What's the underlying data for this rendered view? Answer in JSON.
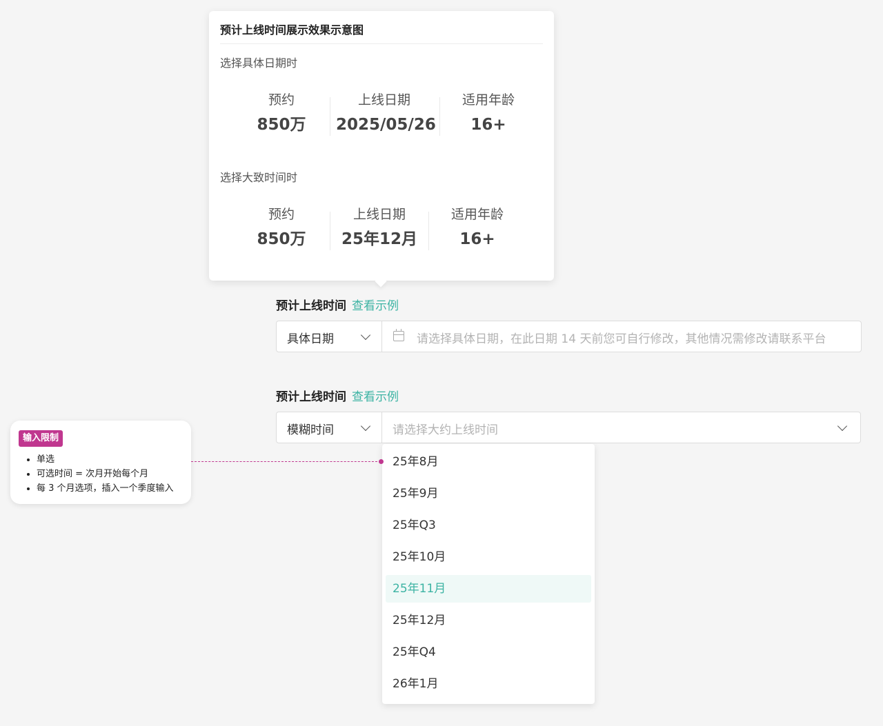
{
  "example_popover": {
    "title": "预计上线时间展示效果示意图",
    "specific": {
      "section": "选择具体日期时",
      "stats": [
        {
          "label": "预约",
          "value": "850万"
        },
        {
          "label": "上线日期",
          "value": "2025/05/26"
        },
        {
          "label": "适用年龄",
          "value": "16+"
        }
      ]
    },
    "approx": {
      "section": "选择大致时间时",
      "stats": [
        {
          "label": "预约",
          "value": "850万"
        },
        {
          "label": "上线日期",
          "value": "25年12月"
        },
        {
          "label": "适用年龄",
          "value": "16+"
        }
      ]
    }
  },
  "field_specific": {
    "label": "预计上线时间",
    "link": "查看示例",
    "mode": "具体日期",
    "placeholder": "请选择具体日期，在此日期 14 天前您可自行修改，其他情况需修改请联系平台"
  },
  "field_fuzzy": {
    "label": "预计上线时间",
    "link": "查看示例",
    "mode": "模糊时间",
    "placeholder": "请选择大约上线时间"
  },
  "dropdown": {
    "options": [
      "25年8月",
      "25年9月",
      "25年Q3",
      "25年10月",
      "25年11月",
      "25年12月",
      "25年Q4",
      "26年1月"
    ],
    "selected_index": 4
  },
  "annotation": {
    "badge": "输入限制",
    "items": [
      "单选",
      "可选时间 = 次月开始每个月",
      "每 3 个月选项，插入一个季度输入"
    ]
  },
  "colors": {
    "accent": "#3cb3a3",
    "annotation": "#c0378f"
  }
}
